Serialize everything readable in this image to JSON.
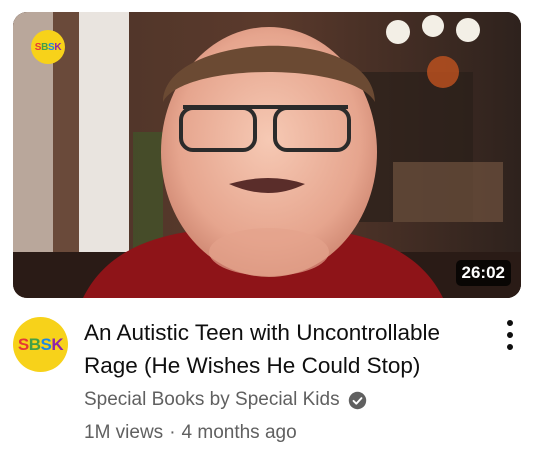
{
  "video": {
    "thumbnail_logo": "SBSK",
    "duration": "26:02",
    "title": "An Autistic Teen with Uncontrollable Rage (He Wishes He Could Stop)",
    "channel": "Special Books by Special Kids",
    "verified_icon": "verified-check-icon",
    "views": "1M views",
    "separator": "·",
    "age": "4 months ago",
    "menu_icon": "more-vert-icon"
  },
  "channel_avatar": {
    "text": "SBSK"
  },
  "colors": {
    "logo_background": "#f7d21a",
    "title_text": "#0f0f0f",
    "meta_text": "#606060"
  }
}
